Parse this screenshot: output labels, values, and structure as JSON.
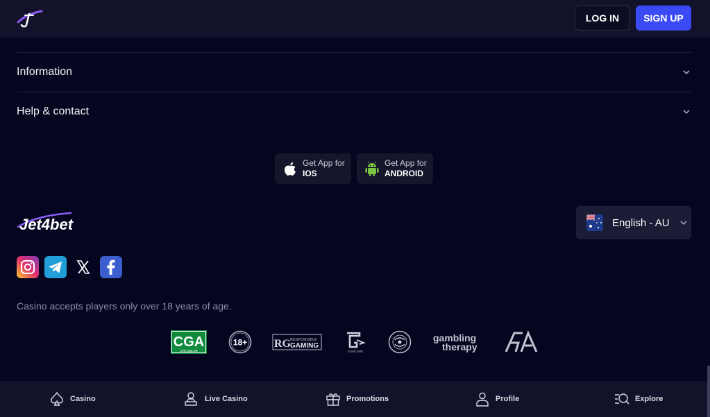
{
  "header": {
    "login_label": "LOG IN",
    "signup_label": "SIGN UP"
  },
  "accordion": [
    {
      "label": "Information"
    },
    {
      "label": "Help & contact"
    }
  ],
  "apps": {
    "ios": {
      "line1": "Get App for",
      "line2": "IOS"
    },
    "android": {
      "line1": "Get App for",
      "line2": "ANDROID"
    }
  },
  "brand": {
    "name": "Jet4bet"
  },
  "language": {
    "selected": "English - AU",
    "flag": "australia-flag-icon"
  },
  "social": [
    "instagram-icon",
    "telegram-icon",
    "x-icon",
    "facebook-icon"
  ],
  "age_note": "Casino accepts players only over 18 years of age.",
  "certs": {
    "cga": {
      "main": "CGA",
      "sub": "cert.cga.cw"
    },
    "age": "18+",
    "rg": {
      "initials": "RG",
      "top": "RESPONSIBLE",
      "bottom": "GAMING"
    },
    "gamcare": "GAMCARE",
    "gambling_therapy": {
      "line1": "gambling",
      "line2": "therapy"
    },
    "ga": "GA"
  },
  "bottom_nav": [
    {
      "label": "Casino",
      "icon": "spade-icon"
    },
    {
      "label": "Live Casino",
      "icon": "dealer-icon"
    },
    {
      "label": "Promotions",
      "icon": "gift-icon"
    },
    {
      "label": "Profile",
      "icon": "user-icon"
    },
    {
      "label": "Explore",
      "icon": "search-list-icon"
    }
  ],
  "colors": {
    "background": "#050520",
    "header": "#12132a",
    "accent": "#3a4bf5",
    "brand_purple": "#7c3aed"
  }
}
